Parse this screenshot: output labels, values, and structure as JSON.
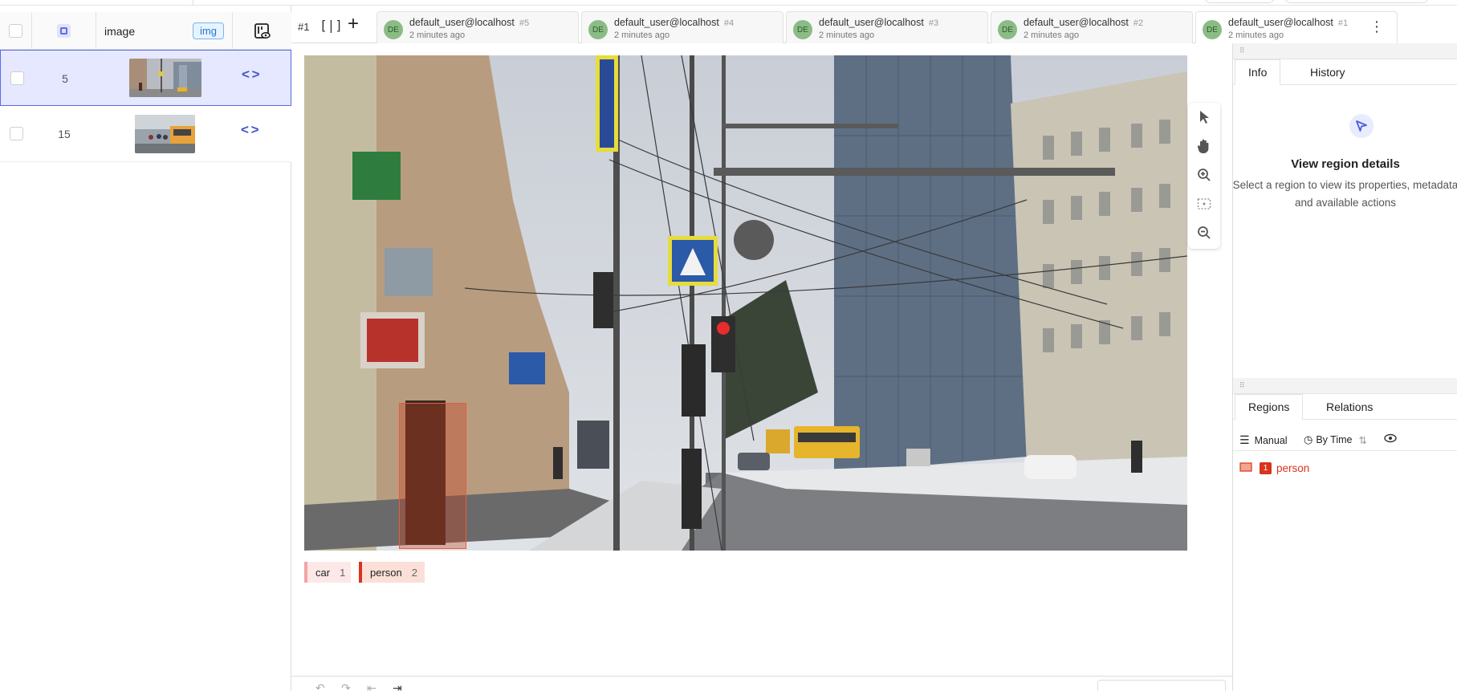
{
  "left_panel": {
    "columns": {
      "image_label": "image",
      "image_tag": "img"
    },
    "rows": [
      {
        "id": "5"
      },
      {
        "id": "15"
      }
    ]
  },
  "tabs_bar": {
    "annotation_id": "#1",
    "split_icon": "[|]",
    "add_label": "+",
    "tabs": [
      {
        "avatar": "DE",
        "user": "default_user@localhost",
        "num": "#5",
        "time": "2 minutes ago"
      },
      {
        "avatar": "DE",
        "user": "default_user@localhost",
        "num": "#4",
        "time": "2 minutes ago"
      },
      {
        "avatar": "DE",
        "user": "default_user@localhost",
        "num": "#3",
        "time": "2 minutes ago"
      },
      {
        "avatar": "DE",
        "user": "default_user@localhost",
        "num": "#2",
        "time": "2 minutes ago"
      },
      {
        "avatar": "DE",
        "user": "default_user@localhost",
        "num": "#1",
        "time": "2 minutes ago"
      }
    ],
    "more_icon": "⋮"
  },
  "labels": [
    {
      "name": "car",
      "count": "1",
      "color": "#f2a3a3"
    },
    {
      "name": "person",
      "count": "2",
      "color": "#d8341e"
    }
  ],
  "right_panel": {
    "tabs_top": {
      "info": "Info",
      "history": "History"
    },
    "info_title": "View region details",
    "info_desc": "Select a region to view its properties, metadata and available actions",
    "tabs_bottom": {
      "regions": "Regions",
      "relations": "Relations"
    },
    "sort": {
      "manual": "Manual",
      "by_time": "By Time"
    },
    "regions": [
      {
        "index": "1",
        "label": "person"
      }
    ]
  },
  "colors": {
    "accent": "#5869e8",
    "region": "#d8341e",
    "selected_row": "#e5e8ff"
  }
}
